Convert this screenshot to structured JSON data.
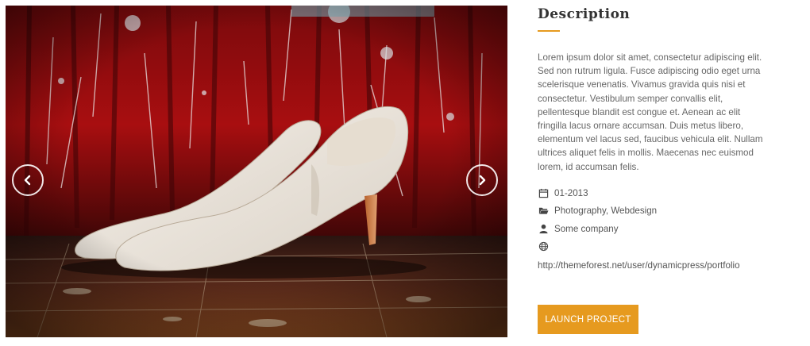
{
  "slider": {
    "prev_icon": "chevron-left-icon",
    "next_icon": "chevron-right-icon"
  },
  "details": {
    "title": "Description",
    "description": "Lorem ipsum dolor sit amet, consectetur adipiscing elit. Sed non rutrum ligula. Fusce adipiscing odio eget urna scelerisque venenatis. Vivamus gravida quis nisi et consectetur. Vestibulum semper convallis elit, pellentesque blandit est congue et. Aenean ac elit fringilla lacus ornare accumsan. Duis metus libero, elementum vel lacus sed, faucibus vehicula elit. Nullam ultrices aliquet felis in mollis. Maecenas nec euismod lorem, id accumsan felis.",
    "meta": {
      "date": "01-2013",
      "categories": "Photography, Webdesign",
      "client": "Some company",
      "url": "http://themeforest.net/user/dynamicpress/portfolio"
    },
    "launch_label": "LAUNCH PROJECT",
    "accent_color": "#e69a1f"
  }
}
